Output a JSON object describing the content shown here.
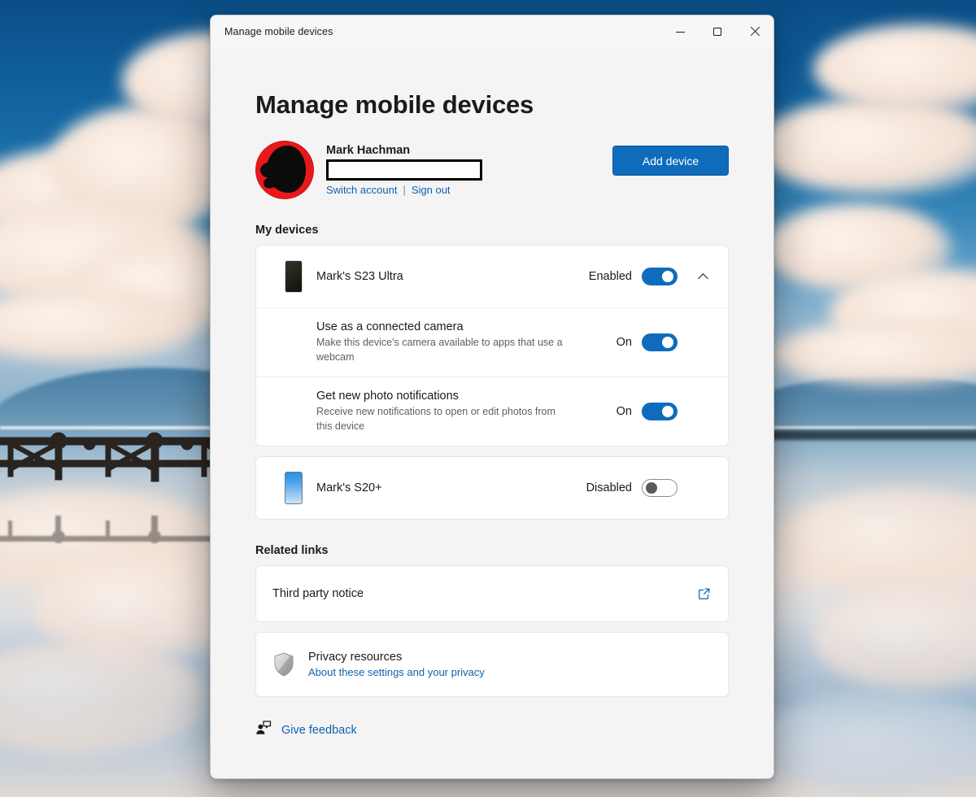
{
  "window": {
    "titlebar_text": "Manage mobile devices",
    "minimize_tooltip": "Minimize",
    "maximize_tooltip": "Maximize",
    "close_tooltip": "Close"
  },
  "page": {
    "title": "Manage mobile devices"
  },
  "account": {
    "name": "Mark Hachman",
    "email_redacted": "",
    "switch_account_label": "Switch account",
    "separator": "|",
    "sign_out_label": "Sign out",
    "add_device_label": "Add device"
  },
  "my_devices": {
    "section_title": "My devices",
    "devices": [
      {
        "name": "Mark's S23 Ultra",
        "state_label": "Enabled",
        "toggle_state": "on",
        "expanded": true,
        "icon": "phone-dark-icon",
        "settings": [
          {
            "title": "Use as a connected camera",
            "description": "Make this device's camera available to apps that use a webcam",
            "state_label": "On",
            "toggle_state": "on"
          },
          {
            "title": "Get new photo notifications",
            "description": "Receive new notifications to open or edit photos from this device",
            "state_label": "On",
            "toggle_state": "on"
          }
        ]
      },
      {
        "name": "Mark's S20+",
        "state_label": "Disabled",
        "toggle_state": "off",
        "expanded": false,
        "icon": "phone-blue-icon",
        "settings": []
      }
    ]
  },
  "related_links": {
    "section_title": "Related links",
    "third_party_notice_label": "Third party notice",
    "privacy": {
      "title": "Privacy resources",
      "link_label": "About these settings and your privacy"
    }
  },
  "feedback": {
    "label": "Give feedback"
  },
  "colors": {
    "accent": "#0f6cbd",
    "link": "#0f62b0",
    "avatar_background": "#e8191b",
    "card_background": "#ffffff",
    "window_background": "#f4f4f4"
  }
}
